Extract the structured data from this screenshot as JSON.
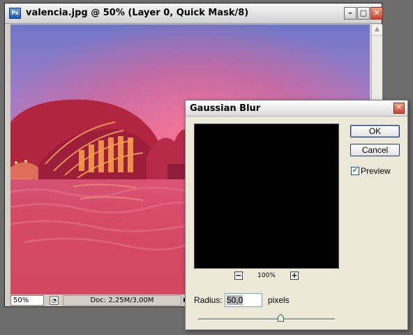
{
  "document": {
    "title": "valencia.jpg @ 50% (Layer 0, Quick Mask/8)",
    "app_icon": "photoshop-icon",
    "controls": [
      "minimize-icon",
      "maximize-icon",
      "close-icon"
    ],
    "status": {
      "zoom": "50%",
      "doc_info": "Doc: 2,25M/3,00M"
    }
  },
  "dialog": {
    "title": "Gaussian Blur",
    "ok_label": "OK",
    "cancel_label": "Cancel",
    "preview_label": "Preview",
    "preview_checked": true,
    "zoom_level": "100%",
    "radius_label": "Radius:",
    "radius_value": "50,0",
    "radius_unit": "pixels",
    "slider_level": 0.6
  },
  "colors": {
    "desktop": "#6d6d6d",
    "dialog_bg": "#ece9d8",
    "quick_mask": "#d44a62"
  }
}
